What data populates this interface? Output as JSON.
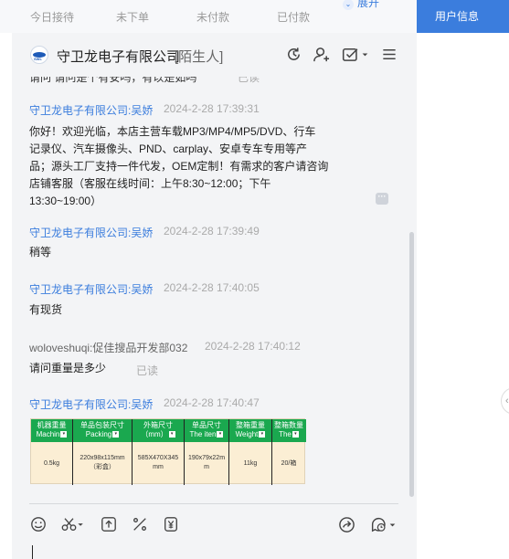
{
  "top_tabs": [
    {
      "label": "今日接待"
    },
    {
      "label": "未下单"
    },
    {
      "label": "未付款"
    },
    {
      "label": "已付款"
    }
  ],
  "expand_label": "展开",
  "side_tab": {
    "label": "用户信息"
  },
  "chat_header": {
    "shop_name": "守卫龙电子有限公司",
    "tag": "[陌生人]",
    "logo_text": "SWL"
  },
  "clipped_message": {
    "text": "请问 请问是个有安吗，有以是如吗",
    "read_status": "已读"
  },
  "messages": [
    {
      "sender": "守卫龙电子有限公司:吴娇",
      "time": "2024-2-28 17:39:31",
      "lines": [
        "你好！欢迎光临，本店主营车载MP3/MP4/MP5/DVD、行车",
        "记录仪、汽车摄像头、PND、carplay、安卓专车专用等产",
        "品；源头工厂支持一件代发，OEM定制！有需求的客户请咨询",
        "店铺客服（客服在线时间：上午8:30~12:00；下午",
        "13:30~19:00）"
      ]
    },
    {
      "sender": "守卫龙电子有限公司:吴娇",
      "time": "2024-2-28 17:39:49",
      "lines": [
        "稍等"
      ]
    },
    {
      "sender": "守卫龙电子有限公司:吴娇",
      "time": "2024-2-28 17:40:05",
      "lines": [
        "有现货"
      ]
    },
    {
      "sender": "woloveshuqi:促佳搜品开发部032",
      "time": "2024-2-28 17:40:12",
      "lines": [
        "请问重量是多少"
      ],
      "read_status": "已读"
    },
    {
      "sender": "守卫龙电子有限公司:吴娇",
      "time": "2024-2-28 17:40:47",
      "lines": []
    }
  ],
  "image_table": {
    "headers": [
      {
        "top": "机器重量",
        "bottom": "Machin"
      },
      {
        "top": "单品包装尺寸",
        "bottom": "Packing"
      },
      {
        "top": "外箱尺寸",
        "bottom": "（mm）"
      },
      {
        "top": "单品尺寸",
        "bottom": "The iten"
      },
      {
        "top": "整箱重量",
        "bottom": "Weight"
      },
      {
        "top": "整箱数量",
        "bottom": "The"
      }
    ],
    "values": [
      {
        "line1": "0.5kg",
        "line2": ""
      },
      {
        "line1": "220x98x115mm",
        "line2": "（彩盒）"
      },
      {
        "line1": "585X470X345",
        "line2": "mm"
      },
      {
        "line1": "190x79x22m",
        "line2": "m"
      },
      {
        "line1": "11kg",
        "line2": ""
      },
      {
        "line1": "20/箱",
        "line2": ""
      }
    ]
  },
  "colors": {
    "accent": "#3b7ddd",
    "panel_bg": "#f3f4f6",
    "table_header": "#1aa84f",
    "table_body": "#fbeed4"
  },
  "header_icons": [
    "refresh-icon",
    "add-contact-icon",
    "checklist-icon",
    "menu-icon"
  ],
  "toolbar_icons": [
    "emoji-icon",
    "scissors-icon",
    "upload-icon",
    "discount-icon",
    "coupon-icon",
    "share-icon",
    "quick-reply-icon"
  ]
}
